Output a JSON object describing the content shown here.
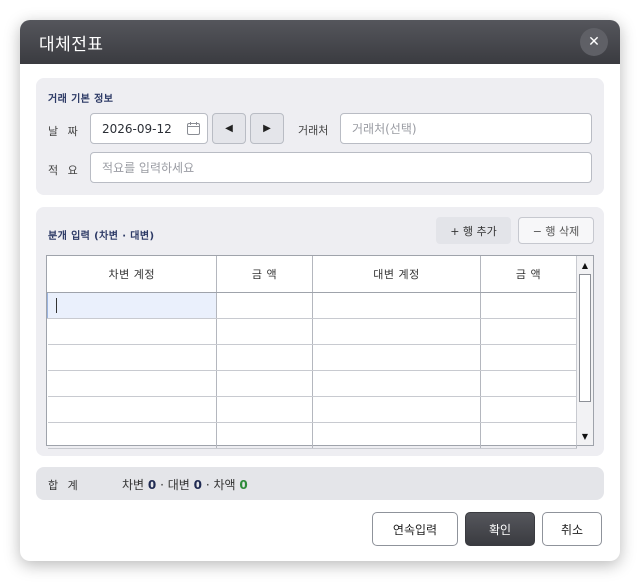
{
  "dialog": {
    "title": "대체전표",
    "close_symbol": "✕"
  },
  "basic_info": {
    "section_title": "거래 기본 정보",
    "date_label": "날 짜",
    "date_value": "2026-09-12",
    "prev_symbol": "◀",
    "next_symbol": "▶",
    "client_label": "거래처",
    "client_placeholder": "거래처(선택)",
    "memo_label": "적 요",
    "memo_placeholder": "적요를 입력하세요"
  },
  "entry": {
    "section_title": "분개 입력 (차변 · 대변)",
    "add_row_label": "+ 행 추가",
    "delete_row_label": "− 행 삭제",
    "columns": [
      "차변 계정",
      "금 액",
      "대변 계정",
      "금 액"
    ],
    "rows": [
      [
        "",
        "",
        "",
        ""
      ],
      [
        "",
        "",
        "",
        ""
      ],
      [
        "",
        "",
        "",
        ""
      ],
      [
        "",
        "",
        "",
        ""
      ],
      [
        "",
        "",
        "",
        ""
      ],
      [
        "",
        "",
        "",
        ""
      ]
    ]
  },
  "totals": {
    "label": "합 계",
    "debit_label": "차변",
    "debit_value": "0",
    "credit_label": "· 대변",
    "credit_value": "0",
    "balance_label": "· 차액",
    "balance_value": "0"
  },
  "footer": {
    "continue_label": "연속입력",
    "ok_label": "확인",
    "cancel_label": "취소"
  },
  "colors": {
    "titlebar": "#3a3b40",
    "panel": "#eeeef2",
    "section_title": "#2d3a66",
    "balance_ok": "#2e8b3a"
  }
}
